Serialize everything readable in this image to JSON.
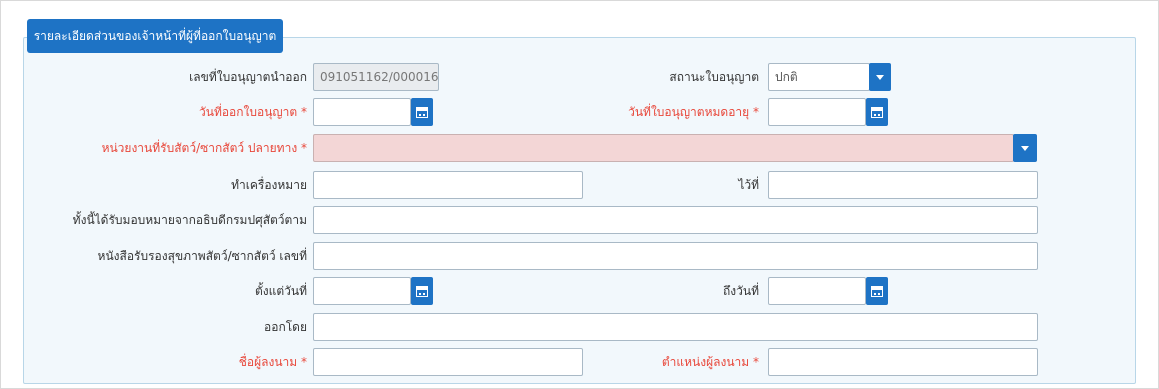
{
  "header": {
    "title": "รายละเอียดส่วนของเจ้าหน้าที่ผู้ที่ออกใบอนุญาต"
  },
  "fields": {
    "license_prev": {
      "label": "เลขที่ใบอนุญาตนำออก",
      "value": "091051162/000016"
    },
    "license_status": {
      "label": "สถานะใบอนุญาต",
      "value": "ปกติ"
    },
    "issue_date": {
      "label": "วันที่ออกใบอนุญาต *",
      "value": ""
    },
    "expire_date": {
      "label": "วันที่ใบอนุญาตหมดอายุ *",
      "value": ""
    },
    "destination_unit": {
      "label": "หน่วยงานที่รับสัตว์/ซากสัตว์ ปลายทาง *",
      "value": ""
    },
    "marking": {
      "label": "ทำเครื่องหมาย",
      "value": ""
    },
    "at": {
      "label": "ไว้ที่",
      "value": ""
    },
    "assigned_by": {
      "label": "ทั้งนี้ได้รับมอบหมายจากอธิบดีกรมปศุสัตว์ตาม",
      "value": ""
    },
    "health_cert": {
      "label": "หนังสือรับรองสุขภาพสัตว์/ซากสัตว์ เลขที่",
      "value": ""
    },
    "from_date": {
      "label": "ตั้งแต่วันที่",
      "value": ""
    },
    "to_date": {
      "label": "ถึงวันที่",
      "value": ""
    },
    "issued_by": {
      "label": "ออกโดย",
      "value": ""
    },
    "signer_name": {
      "label": "ชื่อผู้ลงนาม *",
      "value": ""
    },
    "signer_position": {
      "label": "ตำแหน่งผู้ลงนาม *",
      "value": ""
    }
  },
  "icons": {
    "calendar": "calendar-icon",
    "dropdown": "chevron-down-icon"
  },
  "colors": {
    "accent": "#1e73c5",
    "required": "#e8473a",
    "panel_bg": "#f2f8fc",
    "invalid_bg": "#f3d6d6"
  }
}
